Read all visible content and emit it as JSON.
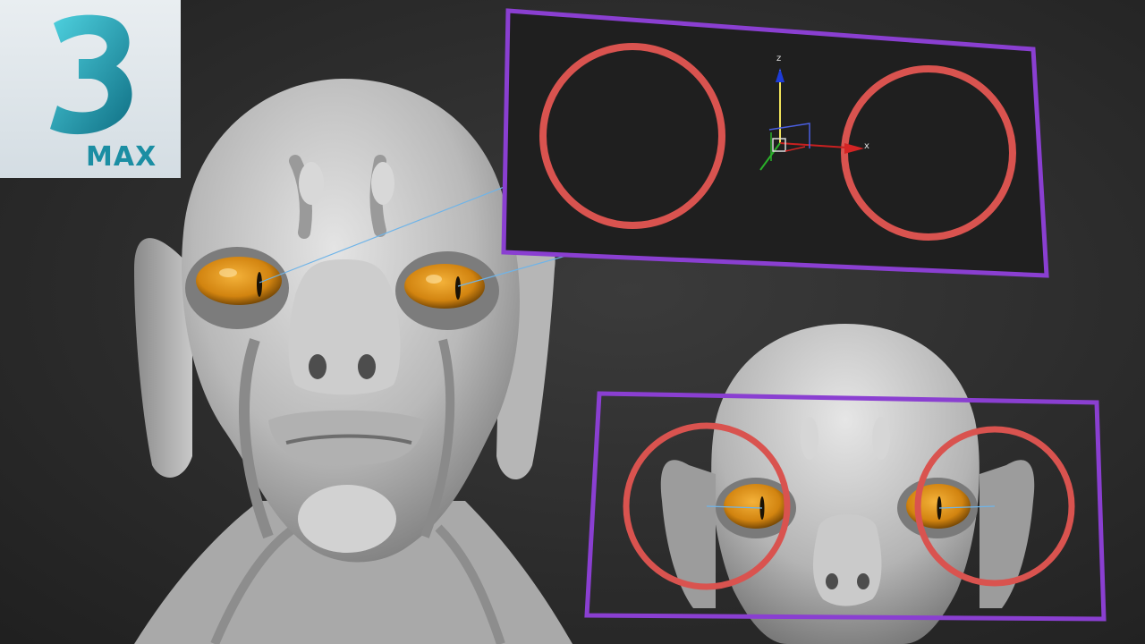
{
  "logo": {
    "numeral": "3",
    "text": "MAX",
    "colors": {
      "numeral_light": "#4fd2e0",
      "numeral_dark": "#0f6f84",
      "text": "#1b8ea3"
    }
  },
  "viewport": {
    "gizmo_axes": {
      "z_label": "z",
      "x_label": "x"
    }
  },
  "colors": {
    "background": "#2a2a2a",
    "frame": "#8a3fd1",
    "ring": "#d9534f",
    "eye": "#d98a10",
    "sight_line": "#6fb4e8",
    "skin": "#c9c9c9"
  }
}
